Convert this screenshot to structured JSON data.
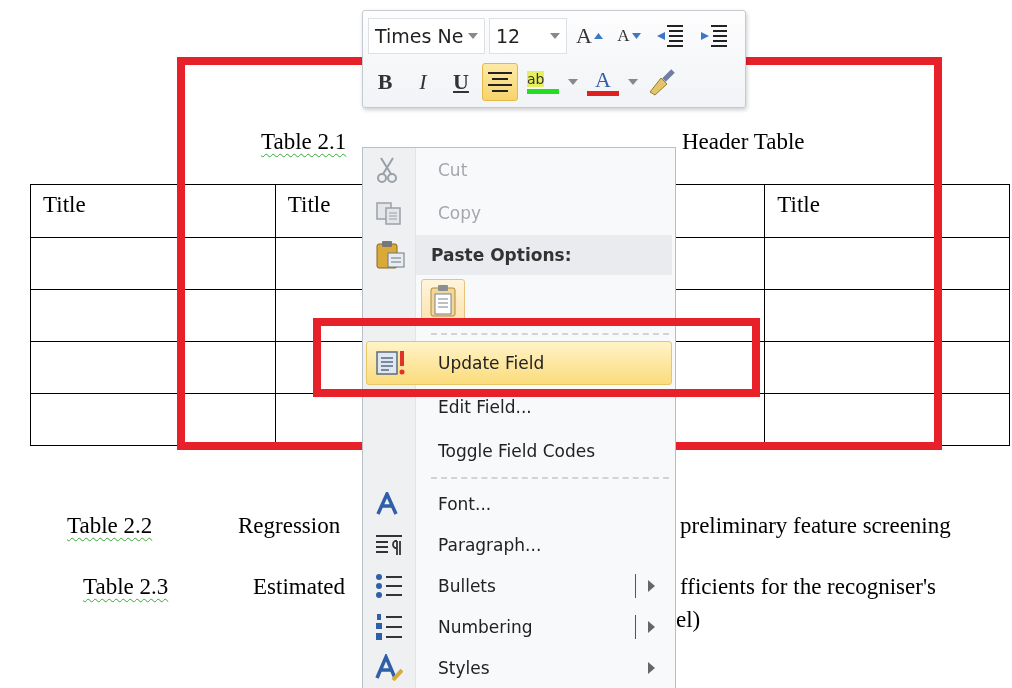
{
  "mini_toolbar": {
    "font": "Times Ne",
    "size": "12",
    "top_buttons": [
      {
        "kind": "grow",
        "label": "A"
      },
      {
        "kind": "shrink",
        "label": "A"
      },
      {
        "kind": "outdent"
      },
      {
        "kind": "indent"
      }
    ],
    "bottom_buttons": [
      {
        "kind": "bold",
        "label": "B",
        "selected": false
      },
      {
        "kind": "italic",
        "label": "I",
        "selected": false
      },
      {
        "kind": "underline",
        "label": "U",
        "selected": false
      },
      {
        "kind": "center",
        "selected": true
      },
      {
        "kind": "highlight",
        "label": "ab",
        "color": "#22dd22",
        "selected": false
      },
      {
        "kind": "font_color",
        "label": "A",
        "color": "#e02020",
        "selected": false
      },
      {
        "kind": "painter",
        "selected": false
      }
    ]
  },
  "caption": {
    "number": "Table 2.1",
    "title_visible": "Header Table"
  },
  "table": {
    "columns": [
      {
        "kind": "text",
        "label": "Title"
      },
      {
        "kind": "text",
        "label": "Title"
      },
      {
        "kind": "blank"
      },
      {
        "kind": "text",
        "label": "Title"
      }
    ]
  },
  "lines": [
    {
      "number": "Table 2.2",
      "left": "Regression",
      "right": "preliminary feature screening"
    },
    {
      "number": "Table 2.3",
      "left": "Estimated",
      "right": "fficients for the recogniser's",
      "continued": "el)"
    }
  ],
  "context_menu": {
    "items": [
      {
        "kind": "cut",
        "label": "Cut",
        "disabled": true,
        "selected": false
      },
      {
        "kind": "copy",
        "label": "Copy",
        "disabled": true,
        "selected": false
      },
      {
        "kind": "paste_header",
        "label": "Paste Options:"
      },
      {
        "kind": "paste_option"
      },
      {
        "kind": "separator"
      },
      {
        "kind": "update_field",
        "label": "Update Field",
        "disabled": false,
        "selected": true
      },
      {
        "kind": "edit_field",
        "label": "Edit Field...",
        "disabled": false,
        "selected": false
      },
      {
        "kind": "toggle",
        "label": "Toggle Field Codes",
        "disabled": false,
        "selected": false
      },
      {
        "kind": "separator"
      },
      {
        "kind": "font",
        "label": "Font...",
        "disabled": false,
        "selected": false
      },
      {
        "kind": "paragraph",
        "label": "Paragraph...",
        "disabled": false,
        "selected": false
      },
      {
        "kind": "bullets",
        "label": "Bullets",
        "disabled": false,
        "selected": false,
        "submenu": true,
        "split": true
      },
      {
        "kind": "numbering",
        "label": "Numbering",
        "disabled": false,
        "selected": false,
        "submenu": true,
        "split": true
      },
      {
        "kind": "styles",
        "label": "Styles",
        "disabled": false,
        "selected": false,
        "submenu": true,
        "split": false
      }
    ]
  }
}
